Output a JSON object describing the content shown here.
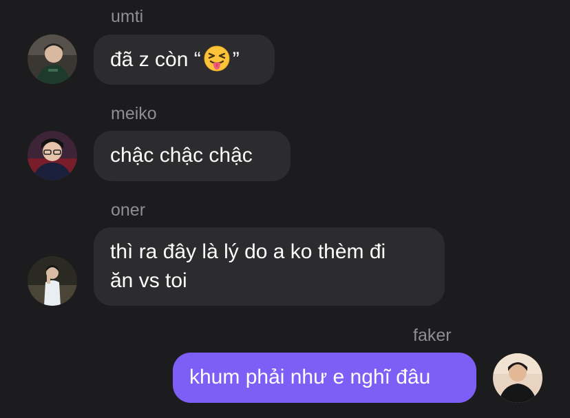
{
  "messages": [
    {
      "sender": "umti",
      "text_before": "đã z còn “",
      "emoji": "squinting-face-with-tongue",
      "text_after": "”",
      "direction": "incoming"
    },
    {
      "sender": "meiko",
      "text": "chậc chậc chậc",
      "direction": "incoming"
    },
    {
      "sender": "oner",
      "line1": "thì ra đây là lý do a ko thèm đi",
      "line2": "ăn vs toi",
      "direction": "incoming"
    },
    {
      "sender": "faker",
      "text": "khum phải như e nghĩ đâu",
      "direction": "outgoing"
    }
  ],
  "colors": {
    "background": "#1c1c1e",
    "incoming_bubble": "#2c2c2e",
    "outgoing_bubble": "#7d5ff5",
    "sender_name": "#8e8e93",
    "message_text": "#ffffff"
  }
}
